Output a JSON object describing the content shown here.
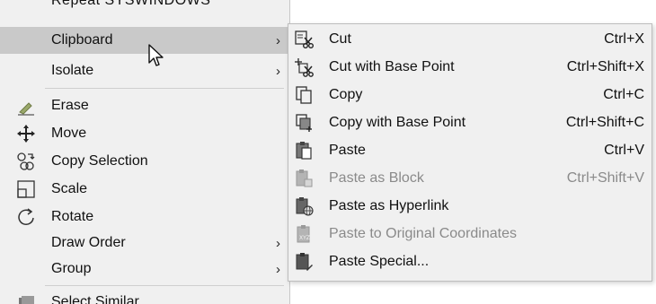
{
  "context_menu": {
    "partial_top_label": "Repeat SYSWINDOWS",
    "items": [
      {
        "label": "Clipboard",
        "has_submenu": true,
        "highlighted": true
      },
      {
        "label": "Isolate",
        "has_submenu": true
      },
      {
        "label": "Erase",
        "icon": "eraser-icon"
      },
      {
        "label": "Move",
        "icon": "move-icon"
      },
      {
        "label": "Copy Selection",
        "icon": "copy-selection-icon"
      },
      {
        "label": "Scale",
        "icon": "scale-icon"
      },
      {
        "label": "Rotate",
        "icon": "rotate-icon"
      },
      {
        "label": "Draw Order",
        "has_submenu": true
      },
      {
        "label": "Group",
        "has_submenu": true
      },
      {
        "label": "Select Similar",
        "icon": "select-similar-icon"
      }
    ]
  },
  "clipboard_submenu": {
    "items": [
      {
        "label": "Cut",
        "shortcut": "Ctrl+X",
        "icon": "cut-icon"
      },
      {
        "label": "Cut with Base Point",
        "shortcut": "Ctrl+Shift+X",
        "icon": "cut-base-point-icon"
      },
      {
        "label": "Copy",
        "shortcut": "Ctrl+C",
        "icon": "copy-icon"
      },
      {
        "label": "Copy with Base Point",
        "shortcut": "Ctrl+Shift+C",
        "icon": "copy-base-point-icon"
      },
      {
        "label": "Paste",
        "shortcut": "Ctrl+V",
        "icon": "paste-icon"
      },
      {
        "label": "Paste as Block",
        "shortcut": "Ctrl+Shift+V",
        "icon": "paste-block-icon",
        "disabled": true
      },
      {
        "label": "Paste as Hyperlink",
        "shortcut": "",
        "icon": "paste-hyperlink-icon"
      },
      {
        "label": "Paste to Original Coordinates",
        "shortcut": "",
        "icon": "paste-original-coords-icon",
        "disabled": true
      },
      {
        "label": "Paste Special...",
        "shortcut": "",
        "icon": "paste-special-icon"
      }
    ]
  },
  "colors": {
    "menu_bg": "#f0f0f0",
    "highlight": "#c9c9c9",
    "disabled_text": "#8a8a8a"
  }
}
